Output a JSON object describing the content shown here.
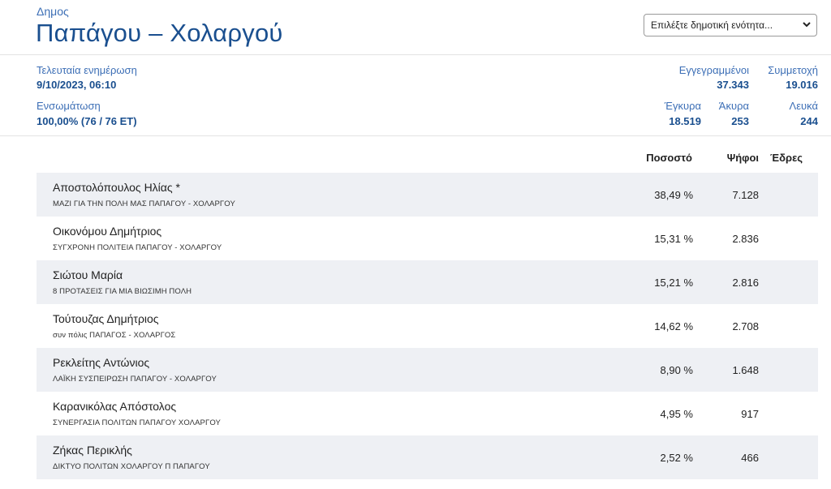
{
  "header": {
    "label": "Δημος",
    "title": "Παπάγου – Χολαργού",
    "select_value": "Επιλέξτε δημοτική ενότητα..."
  },
  "stats": {
    "last_update_label": "Τελευταία ενημέρωση",
    "last_update_value": "9/10/2023, 06:10",
    "integration_label": "Ενσωμάτωση",
    "integration_value": "100,00% (76 / 76 ΕΤ)",
    "registered_label": "Εγγεγραμμένοι",
    "registered_value": "37.343",
    "turnout_label": "Συμμετοχή",
    "turnout_value": "19.016",
    "valid_label": "Έγκυρα",
    "valid_value": "18.519",
    "invalid_label": "Άκυρα",
    "invalid_value": "253",
    "blank_label": "Λευκά",
    "blank_value": "244"
  },
  "table": {
    "headers": {
      "percent": "Ποσοστό",
      "votes": "Ψήφοι",
      "seats": "Έδρες"
    },
    "rows": [
      {
        "name": "Αποστολόπουλος Ηλίας  *",
        "party": "ΜΑΖΙ ΓΙΑ ΤΗΝ ΠΟΛΗ ΜΑΣ ΠΑΠΑΓΟΥ - ΧΟΛΑΡΓΟΥ",
        "percent": "38,49 %",
        "votes": "7.128"
      },
      {
        "name": "Οικονόμου Δημήτριος",
        "party": "ΣΥΓΧΡΟΝΗ ΠΟΛΙΤΕΙΑ ΠΑΠΑΓΟΥ - ΧΟΛΑΡΓΟΥ",
        "percent": "15,31 %",
        "votes": "2.836"
      },
      {
        "name": "Σιώτου Μαρία",
        "party": "8 ΠΡΟΤΑΣΕΙΣ ΓΙΑ ΜΙΑ ΒΙΩΣΙΜΗ ΠΟΛΗ",
        "percent": "15,21 %",
        "votes": "2.816"
      },
      {
        "name": "Τούτουζας Δημήτριος",
        "party": "συν πόλις ΠΑΠΑΓΟΣ - ΧΟΛΑΡΓΟΣ",
        "percent": "14,62 %",
        "votes": "2.708"
      },
      {
        "name": "Ρεκλείτης Αντώνιος",
        "party": "ΛΑΪΚΗ ΣΥΣΠΕΙΡΩΣΗ ΠΑΠΑΓΟΥ - ΧΟΛΑΡΓΟΥ",
        "percent": "8,90 %",
        "votes": "1.648"
      },
      {
        "name": "Καρανικόλας Απόστολος",
        "party": "ΣΥΝΕΡΓΑΣΙΑ ΠΟΛΙΤΩΝ ΠΑΠΑΓΟΥ ΧΟΛΑΡΓΟΥ",
        "percent": "4,95 %",
        "votes": "917"
      },
      {
        "name": "Ζήκας Περικλής",
        "party": "ΔΙΚΤΥΟ ΠΟΛΙΤΩΝ ΧΟΛΑΡΓΟΥ Π ΠΑΠΑΓΟΥ",
        "percent": "2,52 %",
        "votes": "466"
      }
    ]
  }
}
